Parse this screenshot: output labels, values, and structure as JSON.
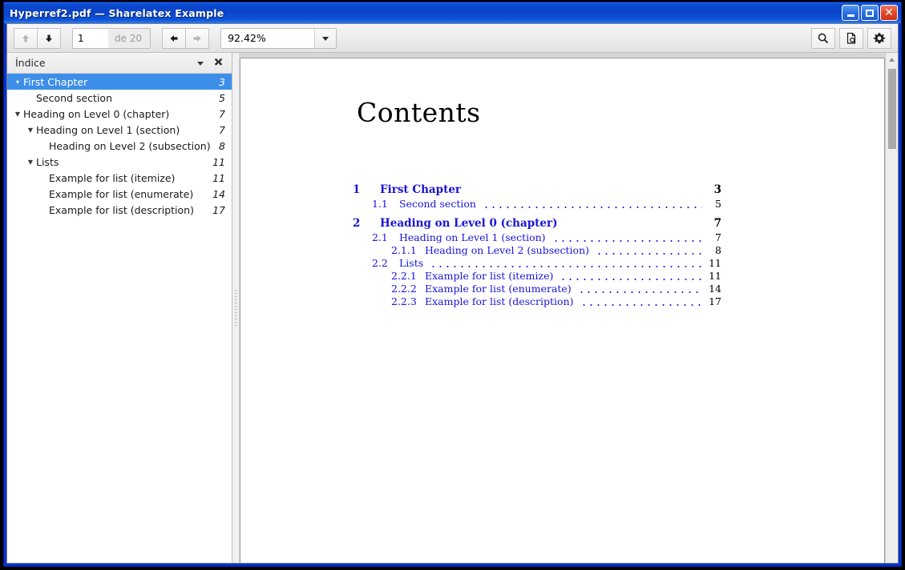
{
  "window": {
    "title": "Hyperref2.pdf — Sharelatex Example",
    "controls": [
      {
        "name": "minimize-button",
        "glyph": "minimize-icon"
      },
      {
        "name": "maximize-button",
        "glyph": "maximize-icon"
      },
      {
        "name": "close-button",
        "glyph": "close-icon",
        "label": "✕"
      }
    ]
  },
  "toolbar": {
    "prev_page_label": "up-arrow-icon",
    "next_page_label": "down-arrow-icon",
    "page_value": "1",
    "page_total_label": "de 20",
    "back_label": "back-arrow-icon",
    "forward_label": "forward-arrow-icon",
    "zoom_value": "92.42%",
    "zoom_dropdown_label": "chevron-down-icon",
    "search_label": "search-icon",
    "document_label": "document-properties-icon",
    "settings_label": "gear-icon"
  },
  "sidebar": {
    "header_title": "Índice",
    "menu_label": "chevron-down-icon",
    "close_label": "✖",
    "items": [
      {
        "label": "First Chapter",
        "page": "3",
        "level": 0,
        "twisty": "▾",
        "selected": true
      },
      {
        "label": "Second section",
        "page": "5",
        "level": 1,
        "twisty": "",
        "selected": false
      },
      {
        "label": "Heading on Level 0 (chapter)",
        "page": "7",
        "level": 0,
        "twisty": "▼",
        "selected": false
      },
      {
        "label": "Heading on Level 1 (section)",
        "page": "7",
        "level": 1,
        "twisty": "▼",
        "selected": false
      },
      {
        "label": "Heading on Level 2 (subsection)",
        "page": "8",
        "level": 2,
        "twisty": "",
        "selected": false
      },
      {
        "label": "Lists",
        "page": "11",
        "level": 1,
        "twisty": "▼",
        "selected": false
      },
      {
        "label": "Example for list (itemize)",
        "page": "11",
        "level": 2,
        "twisty": "",
        "selected": false
      },
      {
        "label": "Example for list (enumerate)",
        "page": "14",
        "level": 2,
        "twisty": "",
        "selected": false
      },
      {
        "label": "Example for list (description)",
        "page": "17",
        "level": 2,
        "twisty": "",
        "selected": false
      }
    ]
  },
  "document": {
    "heading": "Contents",
    "toc": [
      {
        "num": "1",
        "text": "First Chapter",
        "page": "3",
        "kind": "chapter",
        "level": 0
      },
      {
        "num": "1.1",
        "text": "Second section",
        "page": "5",
        "kind": "sub",
        "level": 1
      },
      {
        "num": "2",
        "text": "Heading on Level 0 (chapter)",
        "page": "7",
        "kind": "chapter",
        "level": 0
      },
      {
        "num": "2.1",
        "text": "Heading on Level 1 (section)",
        "page": "7",
        "kind": "sub",
        "level": 1
      },
      {
        "num": "2.1.1",
        "text": "Heading on Level 2 (subsection)",
        "page": "8",
        "kind": "sub",
        "level": 2
      },
      {
        "num": "2.2",
        "text": "Lists",
        "page": "11",
        "kind": "sub",
        "level": 1
      },
      {
        "num": "2.2.1",
        "text": "Example for list (itemize)",
        "page": "11",
        "kind": "sub",
        "level": 2
      },
      {
        "num": "2.2.2",
        "text": "Example for list (enumerate)",
        "page": "14",
        "kind": "sub",
        "level": 2
      },
      {
        "num": "2.2.3",
        "text": "Example for list (description)",
        "page": "17",
        "kind": "sub",
        "level": 2
      }
    ]
  },
  "colors": {
    "titlebar_blue": "#0b43c8",
    "selection_blue": "#3d8ee8",
    "link_blue": "#1a14d8",
    "frame_blue": "#0033cc"
  }
}
